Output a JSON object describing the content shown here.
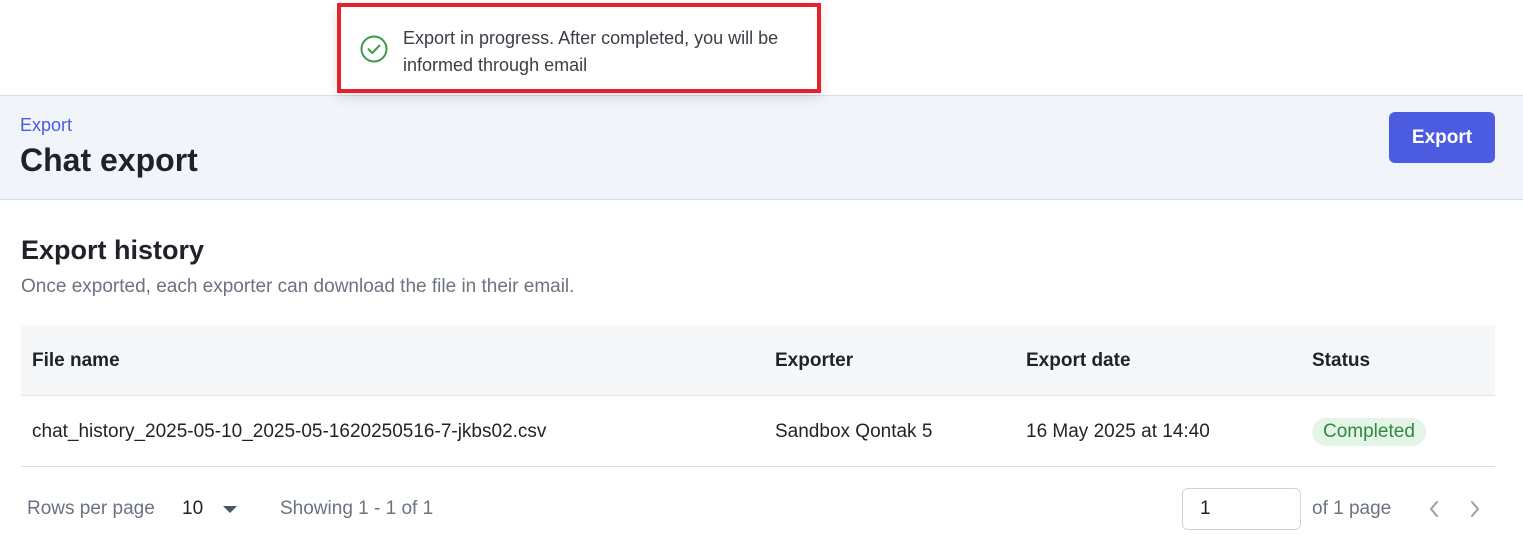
{
  "toast": {
    "message": "Export in progress. After completed, you will be informed through email",
    "icon": "check-circle-icon",
    "highlight_color": "#e5212b",
    "success_color": "#3d9a4b"
  },
  "header": {
    "breadcrumb": "Export",
    "title": "Chat export",
    "export_button": "Export",
    "accent_color": "#4c5ce0"
  },
  "history": {
    "title": "Export history",
    "description": "Once exported, each exporter can download the file in their email."
  },
  "table": {
    "columns": [
      "File name",
      "Exporter",
      "Export date",
      "Status"
    ],
    "rows": [
      {
        "file_name": "chat_history_2025-05-10_2025-05-1620250516-7-jkbs02.csv",
        "exporter": "Sandbox Qontak 5",
        "export_date": "16 May 2025 at 14:40",
        "status": "Completed"
      }
    ]
  },
  "pagination": {
    "rows_per_page_label": "Rows per page",
    "rows_per_page_value": "10",
    "showing": "Showing 1 - 1 of 1",
    "page_value": "1",
    "of_pages": "of 1 page",
    "prev_icon": "chevron-left-icon",
    "next_icon": "chevron-right-icon"
  }
}
